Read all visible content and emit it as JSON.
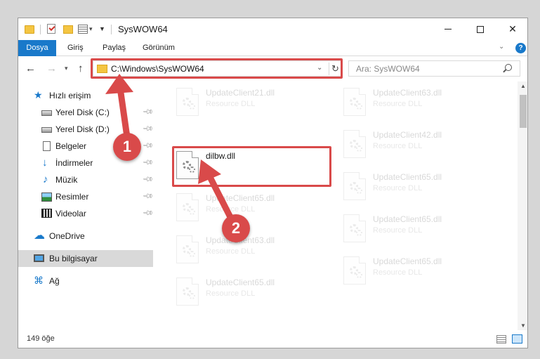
{
  "window": {
    "title": "SysWOW64"
  },
  "ribbon": {
    "tabs": [
      "Dosya",
      "Giriş",
      "Paylaş",
      "Görünüm"
    ],
    "help": "?"
  },
  "address": {
    "path": "C:\\Windows\\SysWOW64"
  },
  "search": {
    "placeholder": "Ara: SysWOW64"
  },
  "sidebar": {
    "items": [
      {
        "label": "Hızlı erişim",
        "icon": "star-icon"
      },
      {
        "label": "Yerel Disk (C:)",
        "icon": "drive-icon",
        "pinned": true
      },
      {
        "label": "Yerel Disk (D:)",
        "icon": "drive-icon",
        "pinned": true
      },
      {
        "label": "Belgeler",
        "icon": "document-icon",
        "pinned": true
      },
      {
        "label": "İndirmeler",
        "icon": "download-icon",
        "pinned": true
      },
      {
        "label": "Müzik",
        "icon": "music-icon",
        "pinned": true
      },
      {
        "label": "Resimler",
        "icon": "pictures-icon",
        "pinned": true
      },
      {
        "label": "Videolar",
        "icon": "video-icon",
        "pinned": true
      },
      {
        "label": "OneDrive",
        "icon": "cloud-icon"
      },
      {
        "label": "Bu bilgisayar",
        "icon": "computer-icon",
        "selected": true
      },
      {
        "label": "Ağ",
        "icon": "network-icon"
      }
    ]
  },
  "files": {
    "left": [
      {
        "name": "UpdateClient21.dll",
        "type": "Resource DLL",
        "faded": true
      },
      {
        "name": "dilbw.dll",
        "type": "",
        "faded": false
      },
      {
        "name": "UpdateClient65.dll",
        "type": "Resource DLL",
        "faded": true
      },
      {
        "name": "UpdateClient63.dll",
        "type": "Resource DLL",
        "faded": true
      },
      {
        "name": "UpdateClient65.dll",
        "type": "Resource DLL",
        "faded": true
      }
    ],
    "right": [
      {
        "name": "UpdateClient63.dll",
        "type": "Resource DLL",
        "faded": true
      },
      {
        "name": "UpdateClient42.dll",
        "type": "Resource DLL",
        "faded": true
      },
      {
        "name": "UpdateClient65.dll",
        "type": "Resource DLL",
        "faded": true
      },
      {
        "name": "UpdateClient65.dll",
        "type": "Resource DLL",
        "faded": true
      },
      {
        "name": "UpdateClient65.dll",
        "type": "Resource DLL",
        "faded": true
      }
    ]
  },
  "status": {
    "count": "149 öğe"
  },
  "annotations": {
    "marker1": "1",
    "marker2": "2",
    "color": "#d94a4a"
  },
  "colors": {
    "accent": "#1979ca"
  }
}
